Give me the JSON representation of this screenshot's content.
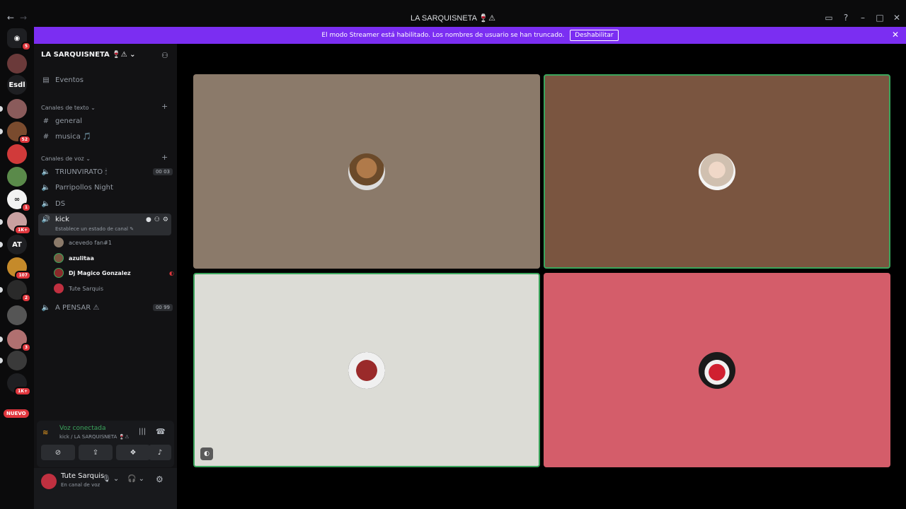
{
  "window": {
    "title": "LA SARQUISNETA 🍷⚠",
    "back": "←",
    "forward": "→",
    "icons": [
      "inbox-icon",
      "help-icon",
      "minimize-icon",
      "maximize-icon",
      "close-icon"
    ]
  },
  "banner": {
    "text": "El modo Streamer está habilitado. Los nombres de usuario se han truncado.",
    "button": "Deshabilitar",
    "close": "✕"
  },
  "rail": {
    "home_badge": "5",
    "servers": [
      {
        "label": "",
        "badge": ""
      },
      {
        "label": "Esdl",
        "badge": ""
      },
      {
        "label": "",
        "badge": ""
      },
      {
        "label": "",
        "badge": "52"
      },
      {
        "label": "",
        "badge": ""
      },
      {
        "label": "",
        "badge": ""
      },
      {
        "label": "",
        "badge": "1"
      },
      {
        "label": "",
        "badge": "1K+"
      },
      {
        "label": "AT",
        "badge": ""
      },
      {
        "label": "",
        "badge": "107"
      },
      {
        "label": "",
        "badge": "2"
      },
      {
        "label": "",
        "badge": ""
      },
      {
        "label": "",
        "badge": "3"
      },
      {
        "label": "",
        "badge": ""
      },
      {
        "label": "",
        "badge": "1K+"
      }
    ],
    "new_label": "NUEVO"
  },
  "sidebar": {
    "guild_name": "LA SARQUISNETA 🍷⚠",
    "events": "Eventos",
    "text_category": "Canales de texto",
    "text_channels": [
      "general",
      "musica 🎵"
    ],
    "voice_category": "Canales de voz",
    "voice_channels": [
      {
        "name": "TRIUNVIRATO 🕯",
        "count": "00  03"
      },
      {
        "name": "Parripollos Night",
        "count": ""
      },
      {
        "name": "DS",
        "count": ""
      }
    ],
    "active_channel": {
      "name": "kick",
      "status": "Establece un estado de canal ✎"
    },
    "users": [
      "acevedo fan#1",
      "azulitaa",
      "Dj Magico Gonzalez",
      "Tute Sarquis"
    ],
    "last_channel": {
      "name": "A PENSAR ⚠",
      "count": "00  99"
    }
  },
  "voice": {
    "status": "Voz conectada",
    "location": "kick / LA SARQUISNETA 🍷⚠"
  },
  "userbar": {
    "name": "Tute Sarquis",
    "status": "En canal de voz"
  },
  "colors": {
    "accent": "#7b2ef2",
    "tile1": "#8b7a6a",
    "tile2": "#7a5540",
    "tile3": "#dcdcd6",
    "tile4": "#d45d6a",
    "speaking": "#3ba55c"
  }
}
